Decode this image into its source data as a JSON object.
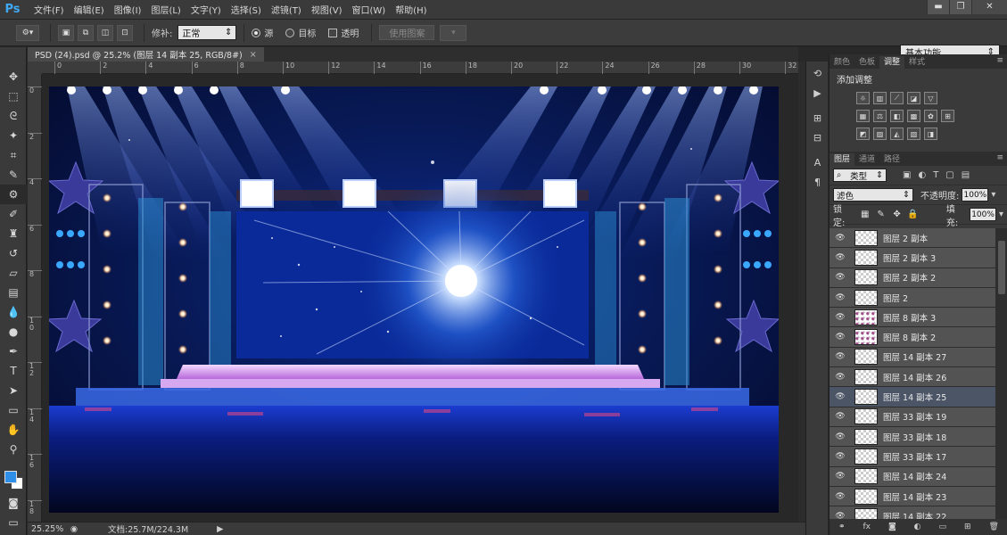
{
  "app": {
    "logo": "Ps"
  },
  "menu": [
    "文件(F)",
    "编辑(E)",
    "图像(I)",
    "图层(L)",
    "文字(Y)",
    "选择(S)",
    "滤镜(T)",
    "视图(V)",
    "窗口(W)",
    "帮助(H)"
  ],
  "window_buttons": {
    "minimize": "▬",
    "restore": "❐",
    "close": "✕"
  },
  "options": {
    "patch_label": "修补:",
    "patch_mode": "正常",
    "source_label": "源",
    "target_label": "目标",
    "transparent_label": "透明",
    "use_pattern_label": "使用图案",
    "workspace": "基本功能"
  },
  "document": {
    "tab_title": "PSD (24).psd @ 25.2% (图层 14 副本 25, RGB/8#)",
    "close": "×"
  },
  "ruler": {
    "h_labels": [
      "0",
      "2",
      "4",
      "6",
      "8",
      "10",
      "12",
      "14",
      "16",
      "18",
      "20",
      "22",
      "24",
      "26",
      "28",
      "30",
      "32"
    ],
    "v_labels": [
      "0",
      "2",
      "4",
      "6",
      "8",
      "1\n0",
      "1\n2",
      "1\n4",
      "1\n6",
      "1\n8"
    ]
  },
  "status": {
    "zoom": "25.25%",
    "doc_info": "文档:25.7M/224.3M"
  },
  "panels": {
    "top_tabs": [
      "颜色",
      "色板",
      "调整",
      "样式"
    ],
    "adjust_title": "添加调整",
    "layer_tabs": [
      "图层",
      "通道",
      "路径"
    ],
    "filter_label": "类型",
    "blend_mode": "滤色",
    "opacity_label": "不透明度:",
    "opacity_value": "100%",
    "lock_label": "锁定:",
    "fill_label": "填充:",
    "fill_value": "100%"
  },
  "layers": [
    {
      "name": "图层 2 副本",
      "selected": false,
      "thumb": "blank"
    },
    {
      "name": "图层 2 副本 3",
      "selected": false,
      "thumb": "blank"
    },
    {
      "name": "图层 2 副本 2",
      "selected": false,
      "thumb": "blank"
    },
    {
      "name": "图层 2",
      "selected": false,
      "thumb": "blank"
    },
    {
      "name": "图层 8 副本 3",
      "selected": false,
      "thumb": "pink"
    },
    {
      "name": "图层 8 副本 2",
      "selected": false,
      "thumb": "pink"
    },
    {
      "name": "图层 14 副本 27",
      "selected": false,
      "thumb": "blank"
    },
    {
      "name": "图层 14 副本 26",
      "selected": false,
      "thumb": "blank"
    },
    {
      "name": "图层 14 副本 25",
      "selected": true,
      "thumb": "blank"
    },
    {
      "name": "图层 33 副本 19",
      "selected": false,
      "thumb": "blank"
    },
    {
      "name": "图层 33 副本 18",
      "selected": false,
      "thumb": "blank"
    },
    {
      "name": "图层 33 副本 17",
      "selected": false,
      "thumb": "blank"
    },
    {
      "name": "图层 14 副本 24",
      "selected": false,
      "thumb": "blank"
    },
    {
      "name": "图层 14 副本 23",
      "selected": false,
      "thumb": "blank"
    },
    {
      "name": "图层 14 副本 22",
      "selected": false,
      "thumb": "blank"
    }
  ],
  "footer_icons": [
    "link-icon",
    "fx-icon",
    "mask-icon",
    "adjustment-icon",
    "folder-icon",
    "new-layer-icon",
    "trash-icon"
  ],
  "colors": {
    "foreground": "#2f8ee8",
    "background": "#ffffff",
    "accent": "#3fa9f5"
  }
}
